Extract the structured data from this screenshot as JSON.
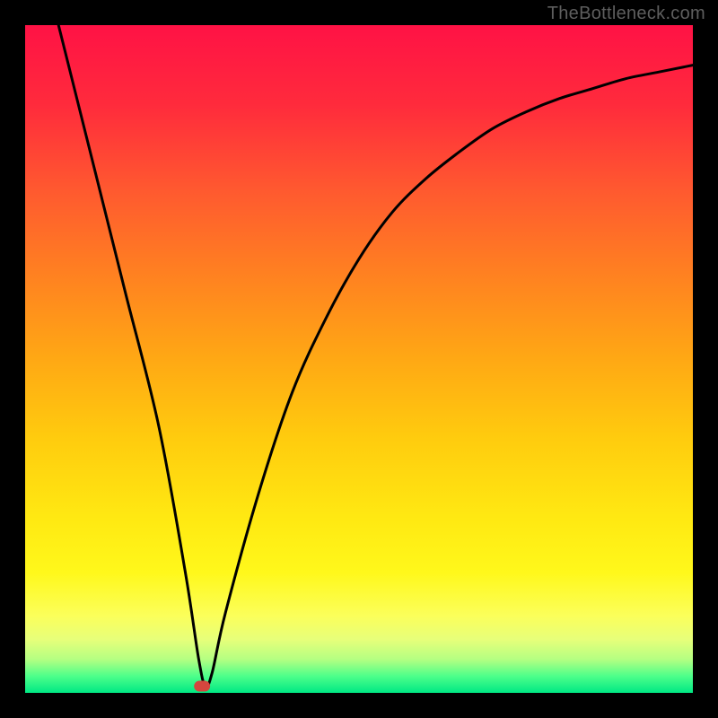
{
  "watermark": "TheBottleneck.com",
  "chart_data": {
    "type": "line",
    "title": "",
    "xlabel": "",
    "ylabel": "",
    "xlim": [
      0,
      100
    ],
    "ylim": [
      0,
      100
    ],
    "grid": false,
    "legend": false,
    "series": [
      {
        "name": "curve",
        "x": [
          5,
          10,
          15,
          20,
          24,
          26,
          27,
          28,
          30,
          35,
          40,
          45,
          50,
          55,
          60,
          65,
          70,
          75,
          80,
          85,
          90,
          95,
          100
        ],
        "y": [
          100,
          80,
          60,
          40,
          18,
          5,
          1,
          3,
          12,
          30,
          45,
          56,
          65,
          72,
          77,
          81,
          84.5,
          87,
          89,
          90.5,
          92,
          93,
          94
        ]
      }
    ],
    "marker": {
      "x": 26.5,
      "y": 1
    },
    "gradient_bands": [
      {
        "pos": 0.0,
        "color": "#ff1245"
      },
      {
        "pos": 0.12,
        "color": "#ff2b3c"
      },
      {
        "pos": 0.25,
        "color": "#ff5a2f"
      },
      {
        "pos": 0.38,
        "color": "#ff8320"
      },
      {
        "pos": 0.5,
        "color": "#ffa814"
      },
      {
        "pos": 0.62,
        "color": "#ffcc0e"
      },
      {
        "pos": 0.74,
        "color": "#ffe912"
      },
      {
        "pos": 0.82,
        "color": "#fff81b"
      },
      {
        "pos": 0.885,
        "color": "#fbff5b"
      },
      {
        "pos": 0.92,
        "color": "#e7ff7a"
      },
      {
        "pos": 0.95,
        "color": "#b4ff82"
      },
      {
        "pos": 0.975,
        "color": "#4dff8a"
      },
      {
        "pos": 1.0,
        "color": "#00e884"
      }
    ]
  }
}
